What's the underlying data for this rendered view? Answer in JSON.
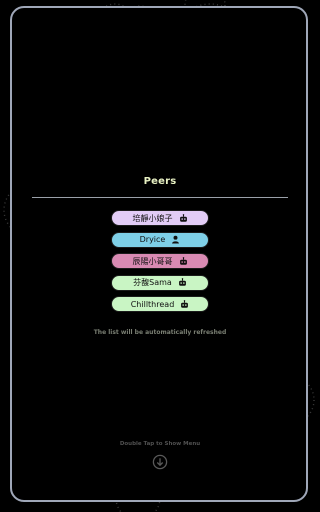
{
  "header": {
    "title": "Peers"
  },
  "peers": [
    {
      "label": "培靜小娘子",
      "color": "#e2ccf6",
      "icon": "robot-icon"
    },
    {
      "label": "Dryice",
      "color": "#7ecfe7",
      "icon": "person-icon"
    },
    {
      "label": "辰陽小哥哥",
      "color": "#d98ab3",
      "icon": "robot-icon"
    },
    {
      "label": "芬馥Sama",
      "color": "#c9f5c4",
      "icon": "robot-icon"
    },
    {
      "label": "Chillthread",
      "color": "#c9f5c4",
      "icon": "robot-icon"
    }
  ],
  "status": {
    "refresh_note": "The list will be automatically refreshed"
  },
  "footer": {
    "hint": "Double Tap to Show Menu",
    "icon": "arrow-down-circle-icon"
  }
}
